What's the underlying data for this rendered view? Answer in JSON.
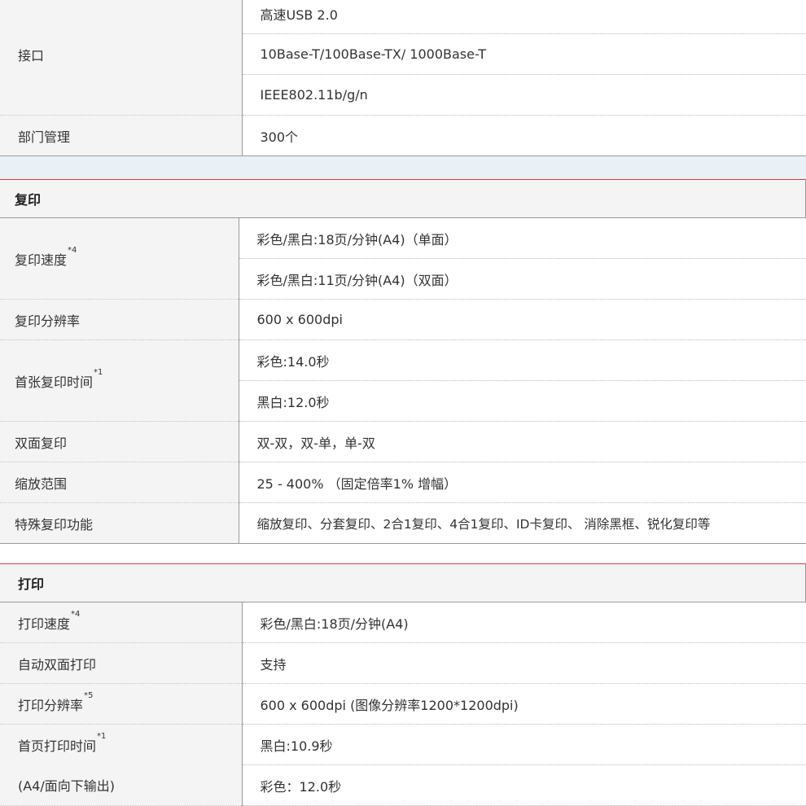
{
  "interface": {
    "label": "接口",
    "values": [
      "高速USB 2.0",
      "10Base-T/100Base-TX/ 1000Base-T",
      "IEEE802.11b/g/n"
    ]
  },
  "department": {
    "label": "部门管理",
    "value": "300个"
  },
  "copy": {
    "title": "复印",
    "speed": {
      "label": "复印速度",
      "note": "*4",
      "values": [
        "彩色/黑白:18页/分钟(A4)（单面）",
        "彩色/黑白:11页/分钟(A4)（双面）"
      ]
    },
    "resolution": {
      "label": "复印分辨率",
      "value": "600 x 600dpi"
    },
    "first_copy": {
      "label": "首张复印时间",
      "note": "*1",
      "values": [
        "彩色:14.0秒",
        "黑白:12.0秒"
      ]
    },
    "duplex": {
      "label": "双面复印",
      "value": "双-双，双-单，单-双"
    },
    "zoom": {
      "label": "缩放范围",
      "value": "25 - 400% （固定倍率1% 增幅）"
    },
    "special": {
      "label": "特殊复印功能",
      "value": "缩放复印、分套复印、2合1复印、4合1复印、ID卡复印、 消除黑框、锐化复印等"
    }
  },
  "print": {
    "title": "打印",
    "speed": {
      "label": "打印速度",
      "note": "*4",
      "value": "彩色/黑白:18页/分钟(A4)"
    },
    "auto_duplex": {
      "label": "自动双面打印",
      "value": "支持"
    },
    "resolution": {
      "label": "打印分辨率",
      "note": "*5",
      "value": "600 x 600dpi (图像分辨率1200*1200dpi)"
    },
    "first_print": {
      "label": "首页打印时间",
      "note": "*1",
      "sublabel": "(A4/面向下输出)",
      "values": [
        "黑白:10.9秒",
        "彩色：12.0秒"
      ]
    }
  }
}
